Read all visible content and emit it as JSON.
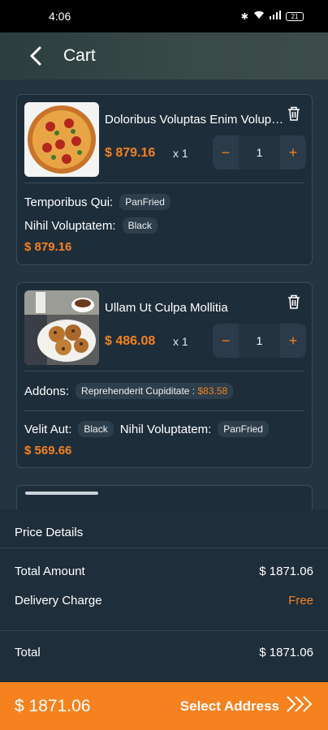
{
  "status_bar": {
    "time": "4:06",
    "battery": "21"
  },
  "header": {
    "title": "Cart"
  },
  "cart_items": [
    {
      "name": "Doloribus Voluptas Enim Voluptatem",
      "price": "$ 879.16",
      "qty_label": "x 1",
      "quantity": "1",
      "options": [
        {
          "label": "Temporibus Qui:",
          "value": "PanFried"
        },
        {
          "label": "Nihil Voluptatem:",
          "value": "Black"
        }
      ],
      "subtotal": "$ 879.16"
    },
    {
      "name": "Ullam Ut Culpa Mollitia",
      "price": "$ 486.08",
      "qty_label": "x 1",
      "quantity": "1",
      "addons_label": "Addons:",
      "addon": {
        "name": "Reprehenderit Cupiditate :",
        "price": "$83.58"
      },
      "options": [
        {
          "label": "Velit Aut:",
          "value": "Black"
        },
        {
          "label": "Nihil Voluptatem:",
          "value": "PanFried"
        }
      ],
      "subtotal": "$ 569.66"
    }
  ],
  "price_details": {
    "title": "Price Details",
    "total_amount_label": "Total Amount",
    "total_amount_value": "$ 1871.06",
    "delivery_label": "Delivery Charge",
    "delivery_value": "Free",
    "total_label": "Total",
    "total_value": "$ 1871.06"
  },
  "footer": {
    "total": "$ 1871.06",
    "select_label": "Select Address"
  },
  "colors": {
    "accent": "#f5821f",
    "background": "#1f2f3a",
    "card": "#1e2d3a"
  }
}
